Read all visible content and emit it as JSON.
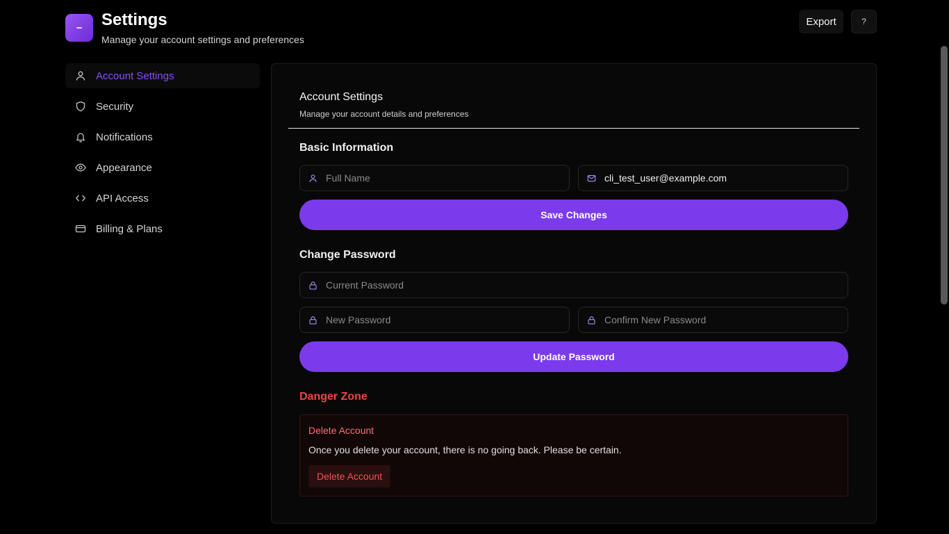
{
  "header": {
    "title": "Settings",
    "subtitle": "Manage your account settings and preferences",
    "export_label": "Export",
    "help_label": "?"
  },
  "sidebar": {
    "items": [
      {
        "label": "Account Settings",
        "icon": "user-icon",
        "active": true
      },
      {
        "label": "Security",
        "icon": "shield-icon"
      },
      {
        "label": "Notifications",
        "icon": "bell-icon"
      },
      {
        "label": "Appearance",
        "icon": "eye-icon"
      },
      {
        "label": "API Access",
        "icon": "code-icon"
      },
      {
        "label": "Billing & Plans",
        "icon": "credit-card-icon"
      }
    ]
  },
  "card": {
    "title": "Account Settings",
    "subtitle": "Manage your account details and preferences"
  },
  "basic_info": {
    "title": "Basic Information",
    "full_name": {
      "placeholder": "Full Name",
      "value": ""
    },
    "email": {
      "placeholder": "Email",
      "value": "cli_test_user@example.com"
    },
    "save_label": "Save Changes"
  },
  "password": {
    "title": "Change Password",
    "current_placeholder": "Current Password",
    "new_placeholder": "New Password",
    "confirm_placeholder": "Confirm New Password",
    "update_label": "Update Password"
  },
  "danger": {
    "title": "Danger Zone",
    "box_title": "Delete Account",
    "description": "Once you delete your account, there is no going back. Please be certain.",
    "delete_label": "Delete Account"
  },
  "colors": {
    "accent": "#7c3aed",
    "accent_text": "#8b4cf6",
    "danger": "#ef4444",
    "background": "#000000"
  }
}
